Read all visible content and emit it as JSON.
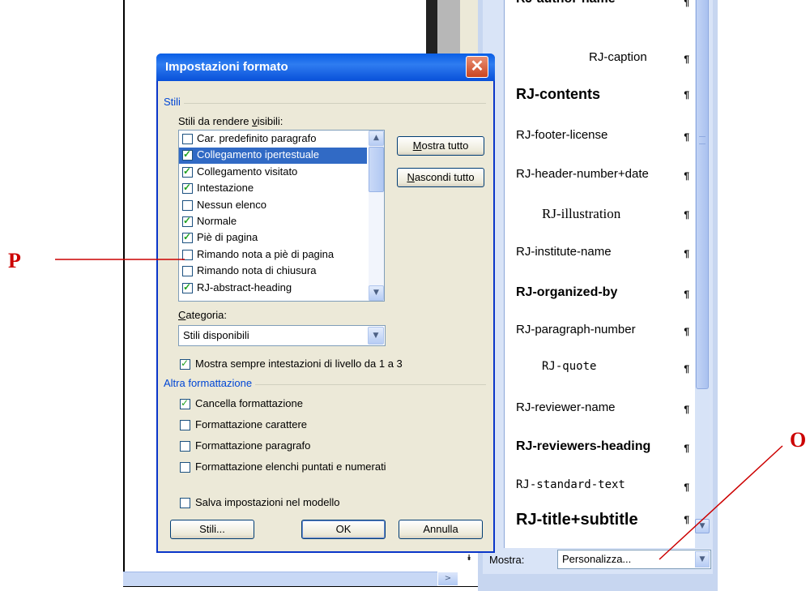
{
  "dialog": {
    "title": "Impostazioni formato",
    "close_glyph": "✕",
    "group_styles": "Stili",
    "visible_styles_label": "Stili da rendere visibili:",
    "styles_list": [
      {
        "label": "Car. predefinito paragrafo",
        "checked": false,
        "selected": false
      },
      {
        "label": "Collegamento ipertestuale",
        "checked": true,
        "selected": true
      },
      {
        "label": "Collegamento visitato",
        "checked": true,
        "selected": false
      },
      {
        "label": "Intestazione",
        "checked": true,
        "selected": false
      },
      {
        "label": "Nessun elenco",
        "checked": false,
        "selected": false
      },
      {
        "label": "Normale",
        "checked": true,
        "selected": false
      },
      {
        "label": "Piè di pagina",
        "checked": true,
        "selected": false
      },
      {
        "label": "Rimando nota a piè di pagina",
        "checked": false,
        "selected": false
      },
      {
        "label": "Rimando nota di chiusura",
        "checked": false,
        "selected": false
      },
      {
        "label": "RJ-abstract-heading",
        "checked": true,
        "selected": false
      }
    ],
    "show_all_button": "Mostra tutto",
    "hide_all_button": "Nascondi tutto",
    "category_label": "Categoria:",
    "category_value": "Stili disponibili",
    "always_show_headings": {
      "label": "Mostra sempre intestazioni di livello da 1 a 3",
      "checked": true
    },
    "group_other": "Altra formattazione",
    "other_options": [
      {
        "label": "Cancella formattazione",
        "checked": true
      },
      {
        "label": "Formattazione carattere",
        "checked": false
      },
      {
        "label": "Formattazione paragrafo",
        "checked": false
      },
      {
        "label": "Formattazione elenchi puntati  e numerati",
        "checked": false
      }
    ],
    "save_in_template": {
      "label": "Salva impostazioni nel modello",
      "checked": false
    },
    "styles_button": "Stili...",
    "ok_button": "OK",
    "cancel_button": "Annulla"
  },
  "style_panel": {
    "items": [
      {
        "name": "RJ-author-name",
        "style": "bold"
      },
      {
        "name": "RJ-caption",
        "style": "indent"
      },
      {
        "name": "RJ-contents",
        "style": "bold-large"
      },
      {
        "name": "RJ-footer-license",
        "style": "normal"
      },
      {
        "name": "RJ-header-number+date",
        "style": "normal"
      },
      {
        "name": "RJ-illustration",
        "style": "serif-indent"
      },
      {
        "name": "RJ-institute-name",
        "style": "normal"
      },
      {
        "name": "RJ-organized-by",
        "style": "bold"
      },
      {
        "name": "RJ-paragraph-number",
        "style": "normal"
      },
      {
        "name": "RJ-quote",
        "style": "mono-indent"
      },
      {
        "name": "RJ-reviewer-name",
        "style": "normal"
      },
      {
        "name": "RJ-reviewers-heading",
        "style": "bold"
      },
      {
        "name": "RJ-standard-text",
        "style": "mono"
      },
      {
        "name": "RJ-title+subtitle",
        "style": "bold-xlarge"
      }
    ],
    "pilcrow": "¶",
    "show_label": "Mostra:",
    "show_value": "Personalizza..."
  },
  "annotations": {
    "p": "P",
    "o": "O"
  },
  "colors": {
    "annotation_red": "#cc0000",
    "titlebar_blue": "#0a5fe6",
    "group_blue": "#0046d5",
    "selection": "#316ac5"
  },
  "icons": {
    "close": "close-icon",
    "scroll_up": "chevron-up-icon",
    "scroll_down": "chevron-down-icon",
    "dropdown": "chevron-down-icon",
    "check": "check-icon",
    "pilcrow": "pilcrow-icon"
  }
}
